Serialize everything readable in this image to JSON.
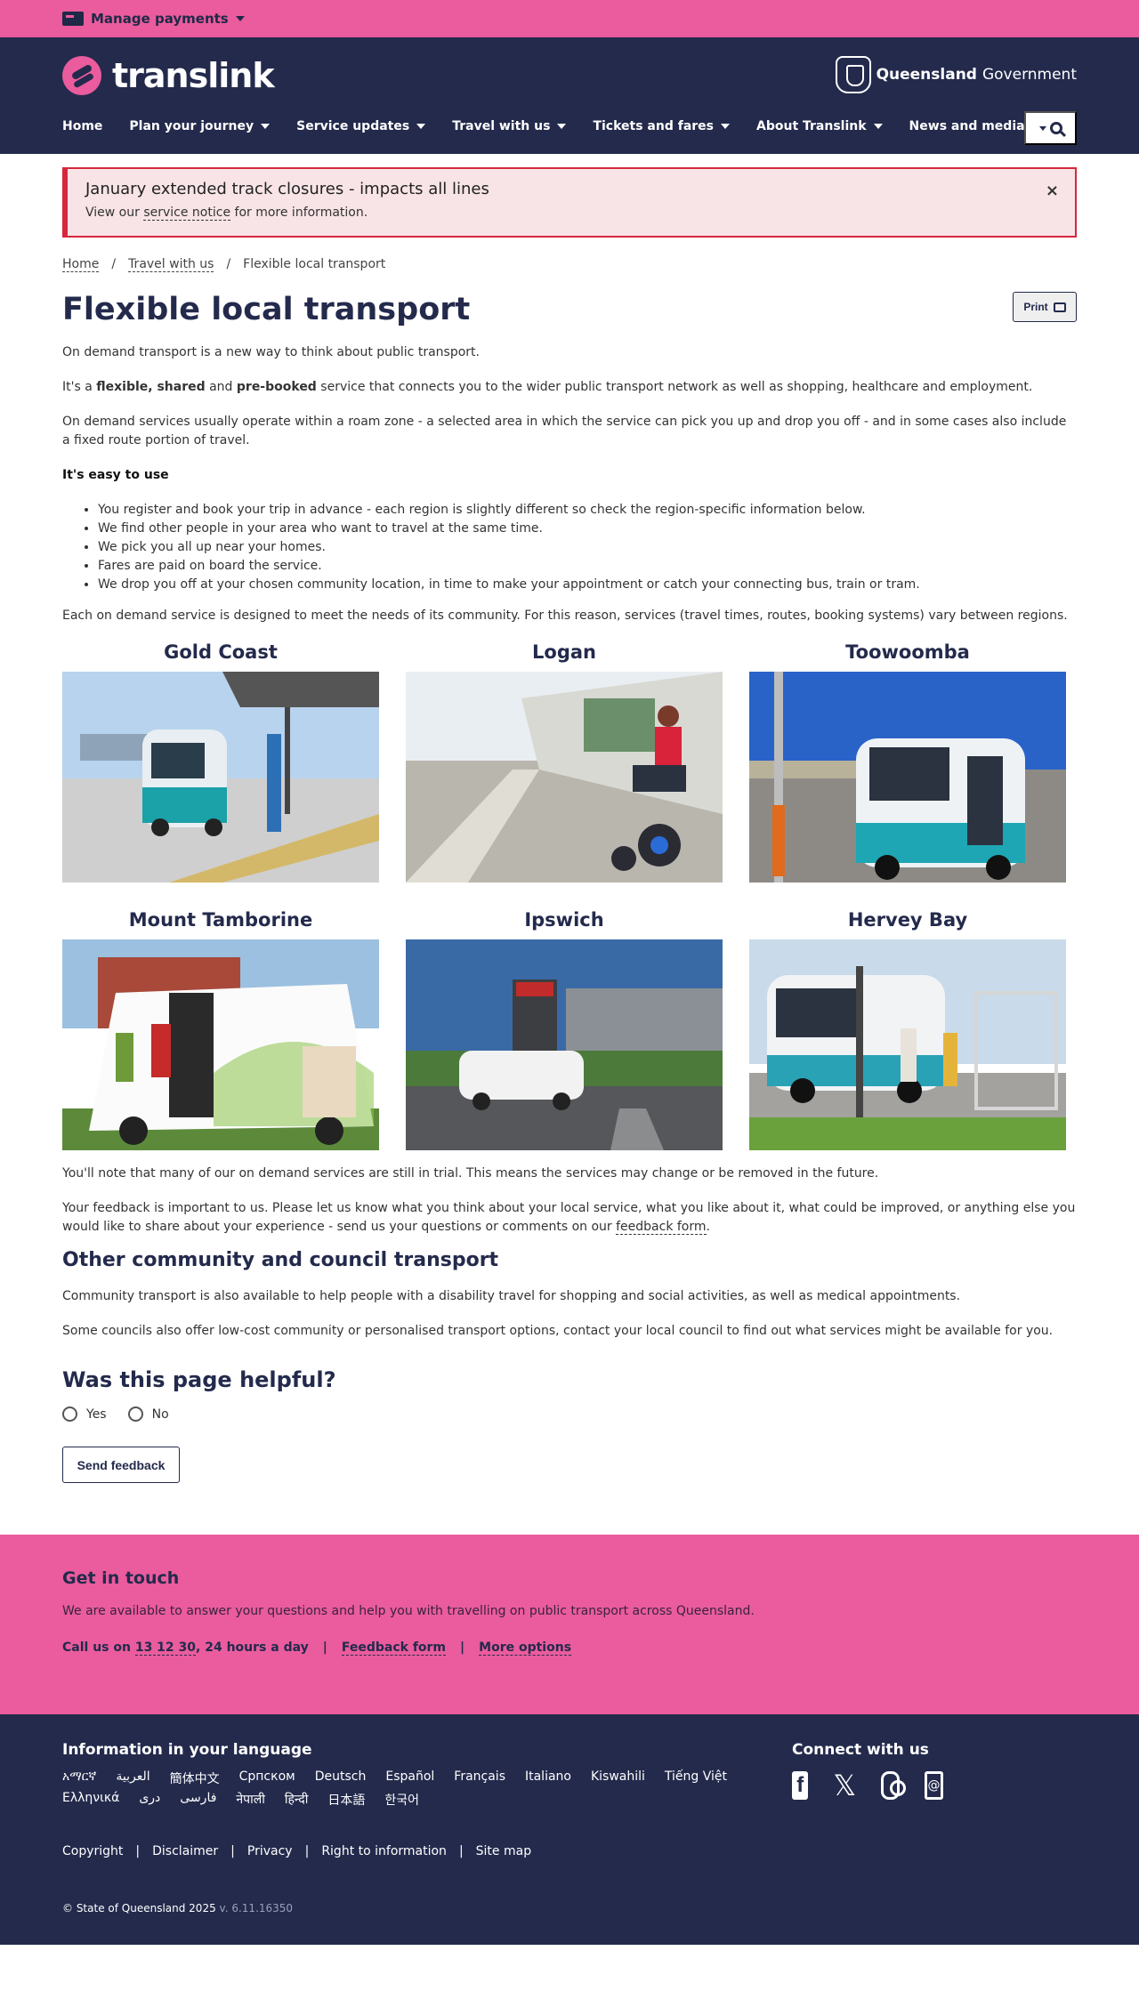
{
  "topbar": {
    "manage_payments": "Manage payments"
  },
  "header": {
    "logo_text": "translink",
    "qld_bold": "Queensland",
    "qld_rest": "Government",
    "nav": [
      "Home",
      "Plan your journey",
      "Service updates",
      "Travel with us",
      "Tickets and fares",
      "About Translink",
      "News and media"
    ]
  },
  "alert": {
    "title": "January extended track closures - impacts all lines",
    "pre": "View our ",
    "link": "service notice",
    "post": " for more information.",
    "close": "×"
  },
  "breadcrumb": {
    "home": "Home",
    "sep": "/",
    "travel": "Travel with us",
    "current": "Flexible local transport"
  },
  "page": {
    "title": "Flexible local transport",
    "print": "Print",
    "p1": "On demand transport is a new way to think about public transport.",
    "p2_a": "It's a ",
    "p2_b": "flexible, shared",
    "p2_c": " and ",
    "p2_d": "pre-booked",
    "p2_e": " service that connects you to the wider public transport network as well as shopping, healthcare and employment.",
    "p3": "On demand services usually operate within a roam zone - a selected area in which the service can pick you up and drop you off - and in some cases also include a fixed route portion of travel.",
    "easy": "It's easy to use",
    "bullets": [
      "You register and book your trip in advance - each region is slightly different so check the region-specific information below.",
      "We find other people in your area who want to travel at the same time.",
      "We pick you all up near your homes.",
      "Fares are paid on board the service.",
      "We drop you off at your chosen community location, in time to make your appointment or catch your connecting bus, train or tram."
    ],
    "p4": "Each on demand service is designed to meet the needs of its community. For this reason, services (travel times, routes, booking systems) vary between regions.",
    "regions": [
      "Gold Coast",
      "Logan",
      "Toowoomba",
      "Mount Tamborine",
      "Ipswich",
      "Hervey Bay"
    ],
    "p5": "You'll note that many of our on demand services are still in trial. This means the services may change or be removed in the future.",
    "p6_a": "Your feedback is important to us. Please let us know what you think about your local service, what you like about it, what could be improved, or anything else you would like to share about your experience - send us your questions or comments on our ",
    "p6_link": "feedback form",
    "p6_b": ".",
    "h2": "Other community and council transport",
    "p7": "Community transport is also available to help people with a disability travel for shopping and social activities, as well as medical appointments.",
    "p8": "Some councils also offer low-cost community or personalised transport options, contact your local council to find out what services might be available for you.",
    "helpful": "Was this page helpful?",
    "yes": "Yes",
    "no": "No",
    "send": "Send feedback"
  },
  "touch": {
    "title": "Get in touch",
    "text": "We are available to answer your questions and help you with travelling on public transport across Queensland.",
    "call_a": "Call us on ",
    "call_num": "13 12 30",
    "call_b": ", 24 hours a day",
    "sep": "|",
    "feedback": "Feedback form",
    "more": "More options"
  },
  "footer": {
    "lang_title": "Information in your language",
    "langs": [
      "አማርኛ",
      "العربية",
      "簡体中文",
      "Српском",
      "Deutsch",
      "Español",
      "Français",
      "Italiano",
      "Kiswahili",
      "Tiếng Việt",
      "Ελληνικά",
      "دری",
      "فارسی",
      "नेपाली",
      "हिन्दी",
      "日本語",
      "한국어"
    ],
    "connect": "Connect with us",
    "social": {
      "fb": "f",
      "x": "𝕏",
      "email": "@"
    },
    "legal": [
      "Copyright",
      "Disclaimer",
      "Privacy",
      "Right to information",
      "Site map"
    ],
    "sep": "|",
    "copyright": "© State of Queensland 2025",
    "version": "v. 6.11.16350"
  }
}
